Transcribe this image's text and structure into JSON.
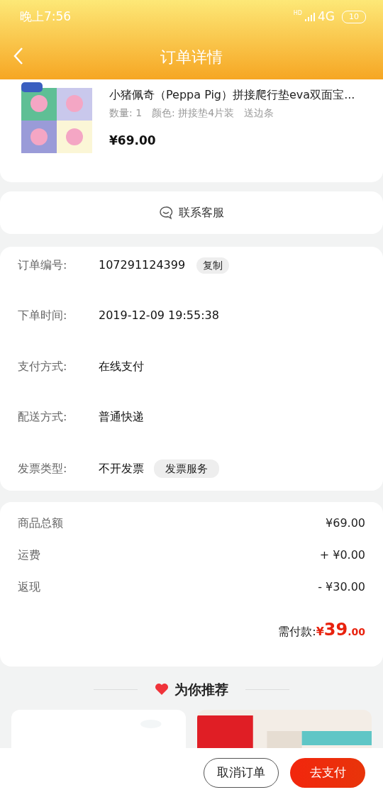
{
  "status_bar": {
    "time": "晚上7:56",
    "hd": "HD",
    "network": "4G",
    "battery": "10"
  },
  "header": {
    "title": "订单详情"
  },
  "product": {
    "title": "小猪佩奇（Peppa Pig）拼接爬行垫eva双面宝...",
    "specs": [
      "数量: 1",
      "颜色: 拼接垫4片装",
      "送边条"
    ],
    "price": "¥69.00"
  },
  "contact": {
    "label": "联系客服"
  },
  "order_info": [
    {
      "label": "订单编号:",
      "value": "107291124399",
      "tag": "复制"
    },
    {
      "label": "下单时间:",
      "value": "2019-12-09 19:55:38"
    },
    {
      "label": "支付方式:",
      "value": "在线支付"
    },
    {
      "label": "配送方式:",
      "value": "普通快递"
    },
    {
      "label": "发票类型:",
      "value": "不开发票",
      "tag": "发票服务"
    }
  ],
  "totals": [
    {
      "label": "商品总额",
      "value": "¥69.00"
    },
    {
      "label": "运费",
      "value": "+ ¥0.00"
    },
    {
      "label": "返现",
      "value": "- ¥30.00"
    }
  ],
  "payable": {
    "label": "需付款:",
    "currency": "¥",
    "integer": "39",
    "decimals": ".00"
  },
  "recommend": {
    "title": "为你推荐"
  },
  "buttons": [
    {
      "label": "取消订单",
      "kind": "outline"
    },
    {
      "label": "去支付",
      "kind": "primary"
    }
  ]
}
